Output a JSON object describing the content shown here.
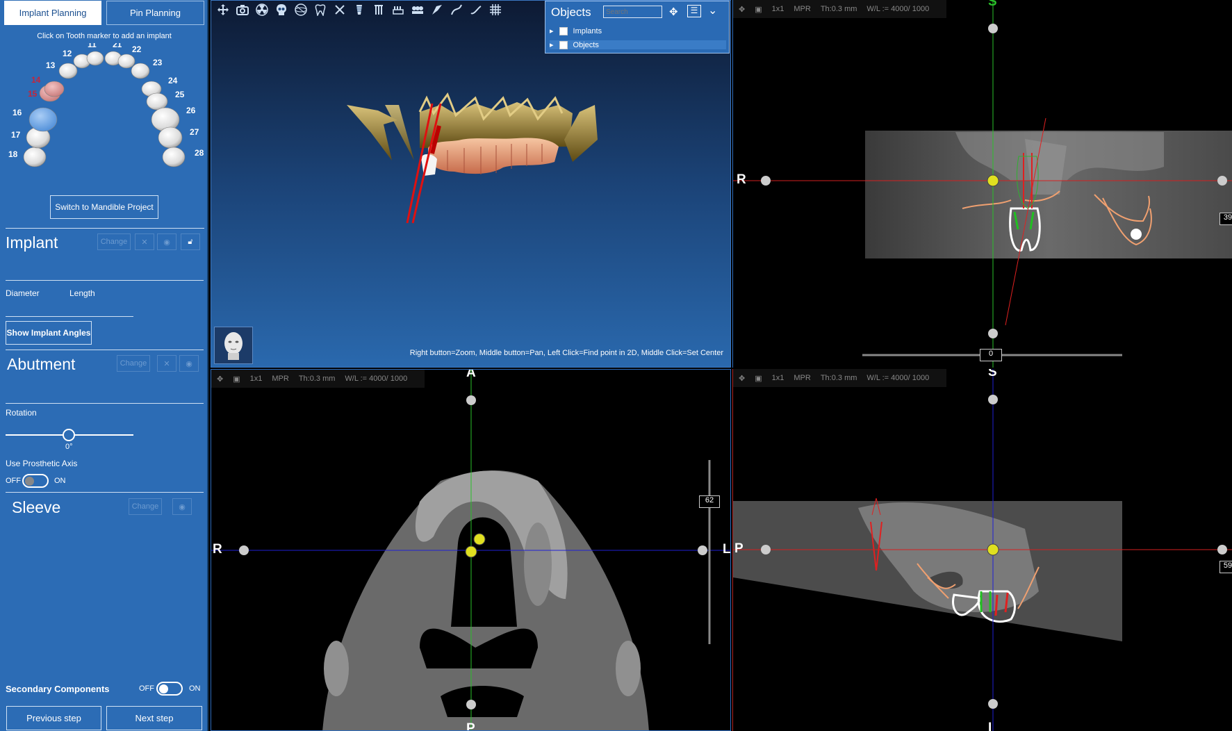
{
  "tabs": {
    "implant_planning": "Implant Planning",
    "pin_planning": "Pin Planning"
  },
  "hint": "Click on Tooth marker to add an implant",
  "teeth_upper_right": [
    "18",
    "17",
    "16",
    "15",
    "14",
    "13",
    "12",
    "11"
  ],
  "teeth_upper_left": [
    "21",
    "22",
    "23",
    "24",
    "25",
    "26",
    "27",
    "28"
  ],
  "highlighted_teeth": {
    "implant_selected": "16",
    "marked_red": [
      "14",
      "15"
    ]
  },
  "switch_button": "Switch to Mandible Project",
  "implant": {
    "title": "Implant",
    "change": "Change",
    "diameter_label": "Diameter",
    "length_label": "Length",
    "show_angles": "Show Implant Angles"
  },
  "abutment": {
    "title": "Abutment",
    "change": "Change",
    "rotation_label": "Rotation",
    "rotation_value": "0°",
    "prosthetic_axis_label": "Use Prosthetic Axis",
    "off": "OFF",
    "on": "ON"
  },
  "sleeve": {
    "title": "Sleeve",
    "change": "Change"
  },
  "secondary": {
    "label": "Secondary Components",
    "off": "OFF",
    "on": "ON"
  },
  "nav": {
    "previous": "Previous step",
    "next": "Next step"
  },
  "view3d": {
    "objects_title": "Objects",
    "search_placeholder": "Search",
    "tree": [
      "Implants",
      "Objects"
    ],
    "help": "Right button=Zoom, Middle button=Pan, Left Click=Find point in 2D, Middle Click=Set Center"
  },
  "mpr_toolbar": {
    "layout": "1x1",
    "mode": "MPR",
    "thickness": "Th:0.3 mm",
    "wl": "W/L := 4000/ 1000"
  },
  "views": {
    "top_right": {
      "top": "S",
      "left": "R",
      "slider_value": "0",
      "side_value": "39"
    },
    "bottom_left": {
      "top": "A",
      "bottom": "P",
      "left": "R",
      "right": "L",
      "slice_value": "62"
    },
    "bottom_right": {
      "top": "S",
      "bottom": "I",
      "left": "P",
      "side_value": "59"
    }
  },
  "colors": {
    "panel": "#2c6cb5",
    "axis_red": "#d42020",
    "axis_green": "#2ac02a",
    "axis_blue": "#2020d4"
  }
}
